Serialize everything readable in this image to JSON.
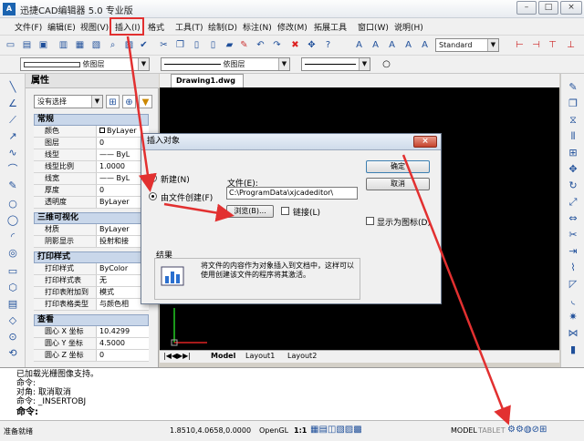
{
  "window": {
    "title": "迅捷CAD编辑器 5.0 专业版",
    "logo": "A",
    "min_label": "–",
    "max_label": "□",
    "close_label": "×"
  },
  "menu": [
    "文件(F)",
    "编辑(E)",
    "视图(V)",
    "插入(I)",
    "格式",
    "工具(T)",
    "绘制(D)",
    "标注(N)",
    "修改(M)",
    "拓展工具",
    "窗口(W)",
    "说明(H)"
  ],
  "toolbar": {
    "text_style": "Standard"
  },
  "properties_bar": {
    "layer_label": "依图层",
    "linetype_label": "依图层"
  },
  "panel": {
    "title": "属性",
    "selection": "没有选择",
    "sections": [
      {
        "name": "常规",
        "rows": [
          [
            "颜色",
            "ByLayer"
          ],
          [
            "图层",
            "0"
          ],
          [
            "线型",
            "—— ByL"
          ],
          [
            "线型比例",
            "1.0000"
          ],
          [
            "线宽",
            "—— ByL"
          ],
          [
            "厚度",
            "0"
          ],
          [
            "透明度",
            "ByLayer"
          ]
        ]
      },
      {
        "name": "三维可视化",
        "rows": [
          [
            "材质",
            "ByLayer"
          ],
          [
            "阴影显示",
            "投射和接"
          ]
        ]
      },
      {
        "name": "打印样式",
        "rows": [
          [
            "打印样式",
            "ByColor"
          ],
          [
            "打印样式表",
            "无"
          ],
          [
            "打印表附加到",
            "模式"
          ],
          [
            "打印表格类型",
            "与颜色相"
          ]
        ]
      },
      {
        "name": "查看",
        "rows": [
          [
            "圆心 X 坐标",
            "10.4299"
          ],
          [
            "圆心 Y 坐标",
            "4.5000"
          ],
          [
            "圆心 Z 坐标",
            "0"
          ]
        ]
      }
    ]
  },
  "doc": {
    "tab": "Drawing1.dwg",
    "layouts": [
      "Model",
      "Layout1",
      "Layout2"
    ]
  },
  "dialog": {
    "title": "插入对象",
    "close_label": "×",
    "opt_new": "新建(N)",
    "opt_file": "由文件创建(F)",
    "file_label": "文件(E):",
    "file_value": "C:\\ProgramData\\xjcadeditor\\",
    "browse": "浏览(B)...",
    "link": "链接(L)",
    "ok": "确定",
    "cancel": "取消",
    "show_icon": "显示为图标(D)",
    "result_label": "结果",
    "result_text": "将文件的内容作为对象插入到文档中，这样可以使用创建该文件的程序将其激活。"
  },
  "command": {
    "lines": [
      "已加载光栅图像支持。",
      "命令:",
      "对角: 取消取消",
      "命令: _INSERTOBJ"
    ],
    "prompt": "命令:"
  },
  "status": {
    "ready": "准备就绪",
    "coords": "1.8510,4.0658,0.0000",
    "opengl": "OpenGL",
    "scale": "1:1",
    "model": "MODEL",
    "tablet": "TABLET"
  }
}
